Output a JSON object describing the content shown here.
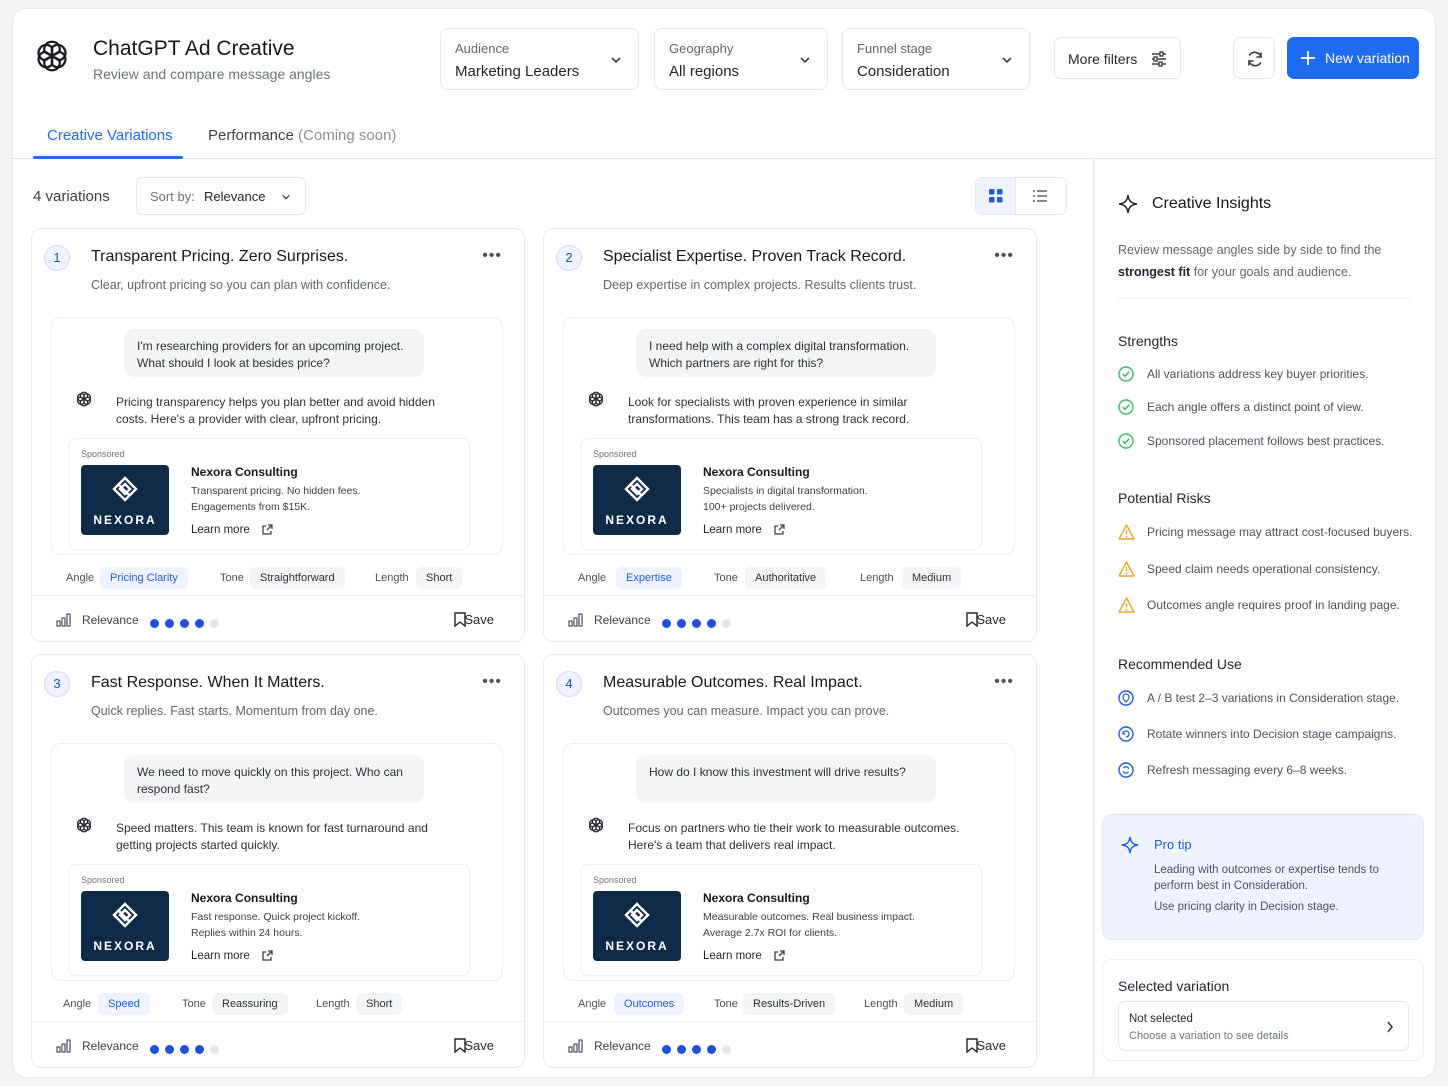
{
  "header": {
    "title": "ChatGPT Ad Creative",
    "subtitle": "Review and compare message angles",
    "filters": [
      {
        "label": "Audience",
        "value": "Marketing Leaders"
      },
      {
        "label": "Geography",
        "value": "All regions"
      },
      {
        "label": "Funnel stage",
        "value": "Consideration"
      }
    ],
    "more_filters": "More filters",
    "new_variation": "New variation",
    "brand_color": "#1f6bf0"
  },
  "tabs": [
    {
      "label": "Creative Variations",
      "active": true
    },
    {
      "label": "Performance",
      "suffix": "(Coming soon)",
      "active": false
    }
  ],
  "toolbar": {
    "count": "4 variations",
    "sort_label": "Sort by:",
    "sort_value": "Relevance"
  },
  "cards": [
    {
      "number": "1",
      "title": "Transparent Pricing. Zero Surprises.",
      "subtitle": "Clear, upfront pricing so you can plan with confidence.",
      "user_msg": "I'm researching providers for an upcoming project. What should I look at besides price?",
      "ai_msg": "Pricing transparency helps you plan better and avoid hidden costs. Here's a provider with clear, upfront pricing.",
      "ad": {
        "sponsored": "Sponsored",
        "logo": "NEXORA",
        "name": "Nexora Consulting",
        "line1": "Transparent pricing. No hidden fees.",
        "line2": "Engagements from $15K.",
        "cta": "Learn more"
      },
      "angle_label": "Angle",
      "angle": "Pricing Clarity",
      "tone_label": "Tone",
      "tone": "Straightforward",
      "length_label": "Length",
      "length": "Short",
      "relevance_label": "Relevance",
      "relevance": 4,
      "relevance_max": 5,
      "save": "Save"
    },
    {
      "number": "2",
      "title": "Specialist Expertise. Proven Track Record.",
      "subtitle": "Deep expertise in complex projects. Results clients trust.",
      "user_msg": "I need help with a complex digital transformation. Which partners are right for this?",
      "ai_msg": "Look for specialists with proven experience in similar transformations. This team has a strong track record.",
      "ad": {
        "sponsored": "Sponsored",
        "logo": "NEXORA",
        "name": "Nexora Consulting",
        "line1": "Specialists in digital transformation.",
        "line2": "100+ projects delivered.",
        "cta": "Learn more"
      },
      "angle_label": "Angle",
      "angle": "Expertise",
      "tone_label": "Tone",
      "tone": "Authoritative",
      "length_label": "Length",
      "length": "Medium",
      "relevance_label": "Relevance",
      "relevance": 4,
      "relevance_max": 5,
      "save": "Save"
    },
    {
      "number": "3",
      "title": "Fast Response. When It Matters.",
      "subtitle": "Quick replies. Fast starts. Momentum from day one.",
      "user_msg": "We need to move quickly on this project. Who can respond fast?",
      "ai_msg": "Speed matters. This team is known for fast turnaround and getting projects started quickly.",
      "ad": {
        "sponsored": "Sponsored",
        "logo": "NEXORA",
        "name": "Nexora Consulting",
        "line1": "Fast response. Quick project kickoff.",
        "line2": "Replies within 24 hours.",
        "cta": "Learn more"
      },
      "angle_label": "Angle",
      "angle": "Speed",
      "tone_label": "Tone",
      "tone": "Reassuring",
      "length_label": "Length",
      "length": "Short",
      "relevance_label": "Relevance",
      "relevance": 4,
      "relevance_max": 5,
      "save": "Save"
    },
    {
      "number": "4",
      "title": "Measurable Outcomes. Real Impact.",
      "subtitle": "Outcomes you can measure. Impact you can prove.",
      "user_msg": "How do I know this investment will drive results?",
      "ai_msg": "Focus on partners who tie their work to measurable outcomes. Here's a team that delivers real impact.",
      "ad": {
        "sponsored": "Sponsored",
        "logo": "NEXORA",
        "name": "Nexora Consulting",
        "line1": "Measurable outcomes. Real business impact.",
        "line2": "Average 2.7x ROI for clients.",
        "cta": "Learn more"
      },
      "angle_label": "Angle",
      "angle": "Outcomes",
      "tone_label": "Tone",
      "tone": "Results-Driven",
      "length_label": "Length",
      "length": "Medium",
      "relevance_label": "Relevance",
      "relevance": 4,
      "relevance_max": 5,
      "save": "Save"
    }
  ],
  "insights": {
    "title": "Creative Insights",
    "desc_pre": "Review message angles side by side to find the",
    "desc_bold": "strongest fit",
    "desc_post": "for your goals and audience.",
    "strengths_title": "Strengths",
    "strengths": [
      "All variations address key buyer priorities.",
      "Each angle offers a distinct point of view.",
      "Sponsored placement follows best practices."
    ],
    "risks_title": "Potential Risks",
    "risks": [
      "Pricing message may attract cost-focused buyers.",
      "Speed claim needs operational consistency.",
      "Outcomes angle requires proof in landing page."
    ],
    "recommended_title": "Recommended Use",
    "recommended": [
      "A / B test 2–3 variations in Consideration stage.",
      "Rotate winners into Decision stage campaigns.",
      "Refresh messaging every 6–8 weeks."
    ],
    "pro_tip_title": "Pro tip",
    "pro_tip_1": "Leading with outcomes or expertise tends to perform best in Consideration.",
    "pro_tip_2": "Use pricing clarity in Decision stage.",
    "selected_title": "Selected variation",
    "selected_value": "Not selected",
    "selected_hint": "Choose a variation to see details",
    "success_color": "#3fb96a",
    "warning_color": "#e7a72a"
  }
}
